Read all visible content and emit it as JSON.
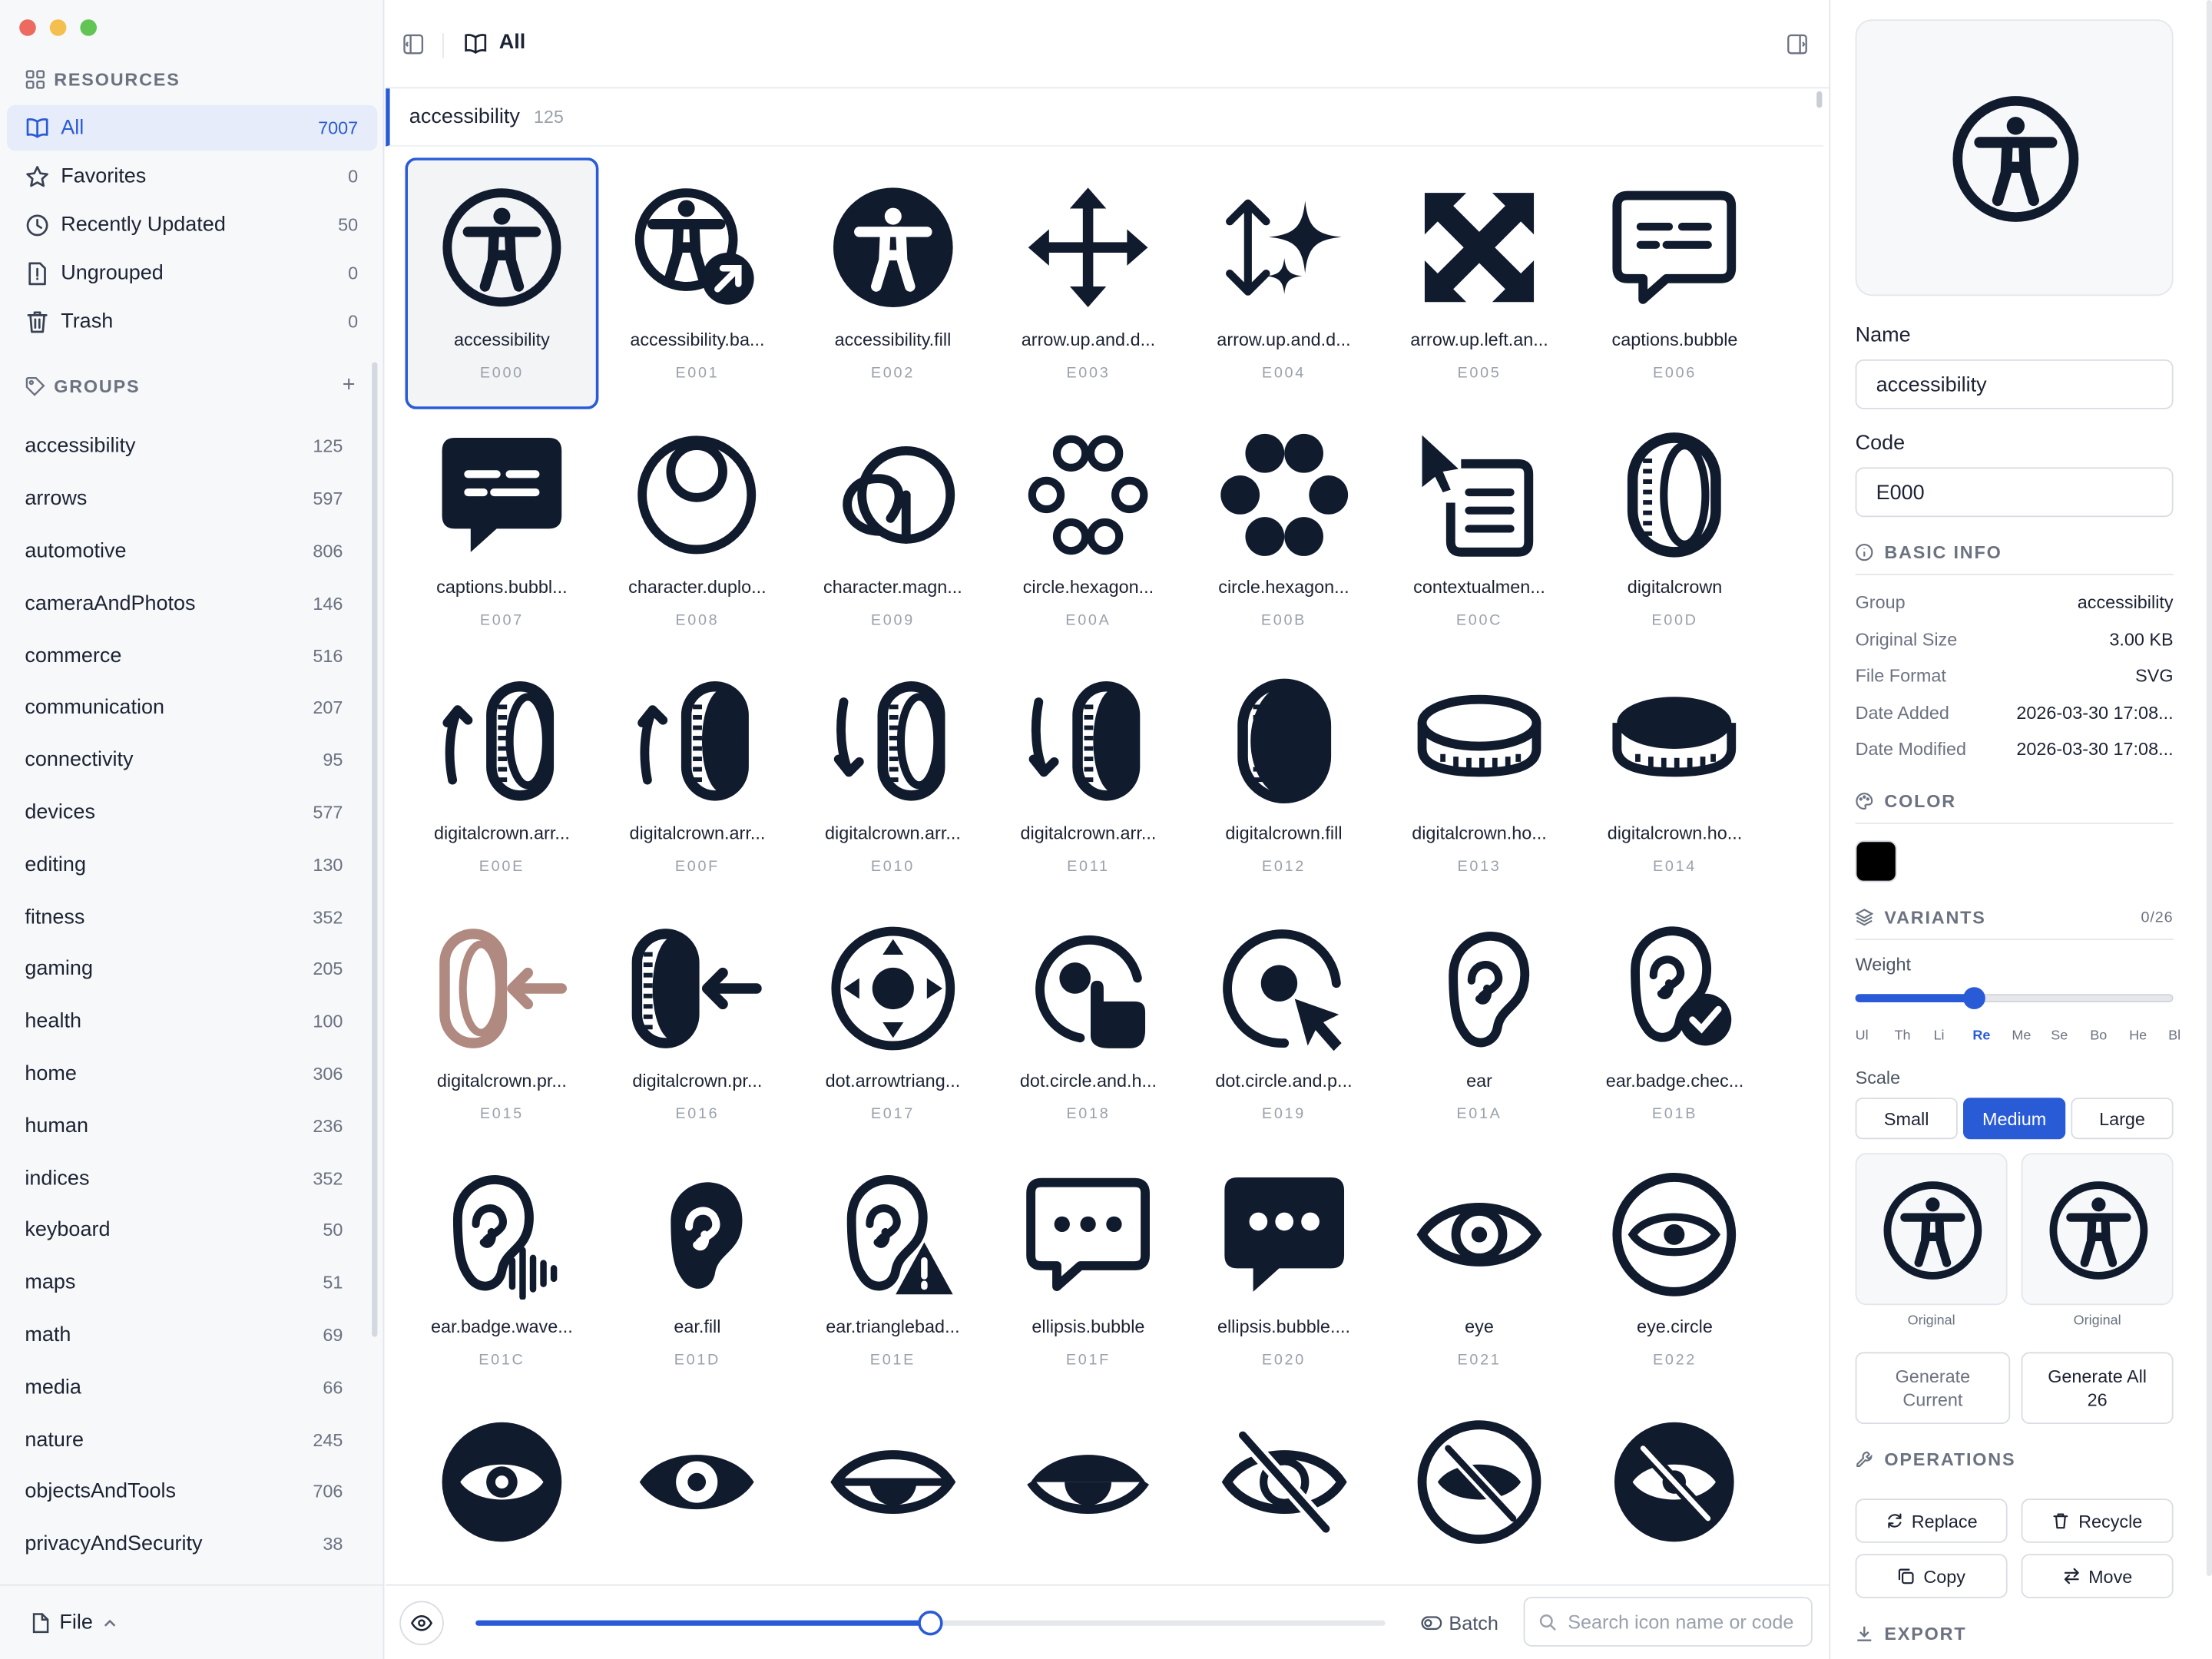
{
  "sidebar": {
    "resources_title": "RESOURCES",
    "resources": [
      {
        "label": "All",
        "count": "7007",
        "icon": "book-open-icon"
      },
      {
        "label": "Favorites",
        "count": "0",
        "icon": "star-icon"
      },
      {
        "label": "Recently Updated",
        "count": "50",
        "icon": "clock-icon"
      },
      {
        "label": "Ungrouped",
        "count": "0",
        "icon": "file-alert-icon"
      },
      {
        "label": "Trash",
        "count": "0",
        "icon": "trash-icon"
      }
    ],
    "groups_title": "GROUPS",
    "add_group_label": "+",
    "groups": [
      {
        "label": "accessibility",
        "count": "125"
      },
      {
        "label": "arrows",
        "count": "597"
      },
      {
        "label": "automotive",
        "count": "806"
      },
      {
        "label": "cameraAndPhotos",
        "count": "146"
      },
      {
        "label": "commerce",
        "count": "516"
      },
      {
        "label": "communication",
        "count": "207"
      },
      {
        "label": "connectivity",
        "count": "95"
      },
      {
        "label": "devices",
        "count": "577"
      },
      {
        "label": "editing",
        "count": "130"
      },
      {
        "label": "fitness",
        "count": "352"
      },
      {
        "label": "gaming",
        "count": "205"
      },
      {
        "label": "health",
        "count": "100"
      },
      {
        "label": "home",
        "count": "306"
      },
      {
        "label": "human",
        "count": "236"
      },
      {
        "label": "indices",
        "count": "352"
      },
      {
        "label": "keyboard",
        "count": "50"
      },
      {
        "label": "maps",
        "count": "51"
      },
      {
        "label": "math",
        "count": "69"
      },
      {
        "label": "media",
        "count": "66"
      },
      {
        "label": "nature",
        "count": "245"
      },
      {
        "label": "objectsAndTools",
        "count": "706"
      },
      {
        "label": "privacyAndSecurity",
        "count": "38"
      }
    ],
    "footer_file": "File"
  },
  "toolbar": {
    "title": "All"
  },
  "group_header": {
    "name": "accessibility",
    "count": "125"
  },
  "icons": [
    {
      "name": "accessibility",
      "code": "E000",
      "glyph": "person-circle"
    },
    {
      "name": "accessibility.ba...",
      "code": "E001",
      "glyph": "person-badge"
    },
    {
      "name": "accessibility.fill",
      "code": "E002",
      "glyph": "person-fill"
    },
    {
      "name": "arrow.up.and.d...",
      "code": "E003",
      "glyph": "move"
    },
    {
      "name": "arrow.up.and.d...",
      "code": "E004",
      "glyph": "updown-sparkle"
    },
    {
      "name": "arrow.up.left.an...",
      "code": "E005",
      "glyph": "expand"
    },
    {
      "name": "captions.bubble",
      "code": "E006",
      "glyph": "bubble-captions"
    },
    {
      "name": "captions.bubbl...",
      "code": "E007",
      "glyph": "bubble-captions-fill"
    },
    {
      "name": "character.duplo...",
      "code": "E008",
      "glyph": "duplo"
    },
    {
      "name": "character.magn...",
      "code": "E009",
      "glyph": "magn"
    },
    {
      "name": "circle.hexagon...",
      "code": "E00A",
      "glyph": "hex-outline"
    },
    {
      "name": "circle.hexagon...",
      "code": "E00B",
      "glyph": "hex-fill"
    },
    {
      "name": "contextualmen...",
      "code": "E00C",
      "glyph": "context-menu"
    },
    {
      "name": "digitalcrown",
      "code": "E00D",
      "glyph": "crown"
    },
    {
      "name": "digitalcrown.arr...",
      "code": "E00E",
      "glyph": "crown-up"
    },
    {
      "name": "digitalcrown.arr...",
      "code": "E00F",
      "glyph": "crown-up-fill"
    },
    {
      "name": "digitalcrown.arr...",
      "code": "E010",
      "glyph": "crown-down"
    },
    {
      "name": "digitalcrown.arr...",
      "code": "E011",
      "glyph": "crown-down-fill"
    },
    {
      "name": "digitalcrown.fill",
      "code": "E012",
      "glyph": "crown-fill"
    },
    {
      "name": "digitalcrown.ho...",
      "code": "E013",
      "glyph": "crown-h"
    },
    {
      "name": "digitalcrown.ho...",
      "code": "E014",
      "glyph": "crown-h-fill"
    },
    {
      "name": "digitalcrown.pr...",
      "code": "E015",
      "glyph": "crown-press"
    },
    {
      "name": "digitalcrown.pr...",
      "code": "E016",
      "glyph": "crown-press-fill"
    },
    {
      "name": "dot.arrowtriang...",
      "code": "E017",
      "glyph": "dpad"
    },
    {
      "name": "dot.circle.and.h...",
      "code": "E018",
      "glyph": "dot-hand"
    },
    {
      "name": "dot.circle.and.p...",
      "code": "E019",
      "glyph": "dot-pointer"
    },
    {
      "name": "ear",
      "code": "E01A",
      "glyph": "ear"
    },
    {
      "name": "ear.badge.chec...",
      "code": "E01B",
      "glyph": "ear-check"
    },
    {
      "name": "ear.badge.wave...",
      "code": "E01C",
      "glyph": "ear-wave"
    },
    {
      "name": "ear.fill",
      "code": "E01D",
      "glyph": "ear-fill"
    },
    {
      "name": "ear.trianglebad...",
      "code": "E01E",
      "glyph": "ear-warn"
    },
    {
      "name": "ellipsis.bubble",
      "code": "E01F",
      "glyph": "bubble-dots"
    },
    {
      "name": "ellipsis.bubble....",
      "code": "E020",
      "glyph": "bubble-dots-fill"
    },
    {
      "name": "eye",
      "code": "E021",
      "glyph": "eye"
    },
    {
      "name": "eye.circle",
      "code": "E022",
      "glyph": "eye-circle"
    },
    {
      "name": "",
      "code": "",
      "glyph": "eye-circle-fill"
    },
    {
      "name": "",
      "code": "",
      "glyph": "eye-fill"
    },
    {
      "name": "",
      "code": "",
      "glyph": "eye-half"
    },
    {
      "name": "",
      "code": "",
      "glyph": "eye-half-fill"
    },
    {
      "name": "",
      "code": "",
      "glyph": "eye-slash"
    },
    {
      "name": "",
      "code": "",
      "glyph": "eye-slash-circle"
    },
    {
      "name": "",
      "code": "",
      "glyph": "eye-slash-circle-fill"
    }
  ],
  "bottombar": {
    "batch_label": "Batch",
    "search_placeholder": "Search icon name or code",
    "size_slider_value": 0.5
  },
  "detail": {
    "name_label": "Name",
    "name_value": "accessibility",
    "code_label": "Code",
    "code_value": "E000",
    "basic_info_title": "BASIC INFO",
    "info": [
      {
        "key": "Group",
        "value": "accessibility"
      },
      {
        "key": "Original Size",
        "value": "3.00 KB"
      },
      {
        "key": "File Format",
        "value": "SVG"
      },
      {
        "key": "Date Added",
        "value": "2026-03-30 17:08..."
      },
      {
        "key": "Date Modified",
        "value": "2026-03-30 17:08..."
      }
    ],
    "color_title": "COLOR",
    "color_value": "#000000",
    "variants_title": "VARIANTS",
    "variants_count": "0/26",
    "weight_label": "Weight",
    "weights": [
      "Ul",
      "Th",
      "Li",
      "Re",
      "Me",
      "Se",
      "Bo",
      "He",
      "Bl"
    ],
    "weight_selected": "Re",
    "scale_label": "Scale",
    "scales": [
      "Small",
      "Medium",
      "Large"
    ],
    "scale_selected": "Medium",
    "variant_previews": [
      {
        "caption": "Original"
      },
      {
        "caption": "Original"
      }
    ],
    "generate_current": "Generate Current",
    "generate_all": "Generate All 26",
    "operations_title": "OPERATIONS",
    "operations": [
      "Replace",
      "Recycle",
      "Copy",
      "Move"
    ],
    "export_title": "EXPORT"
  },
  "colors": {
    "accent": "#2a5bd7",
    "icon": "#111b2e",
    "tinted_icon": "#b08a80"
  }
}
